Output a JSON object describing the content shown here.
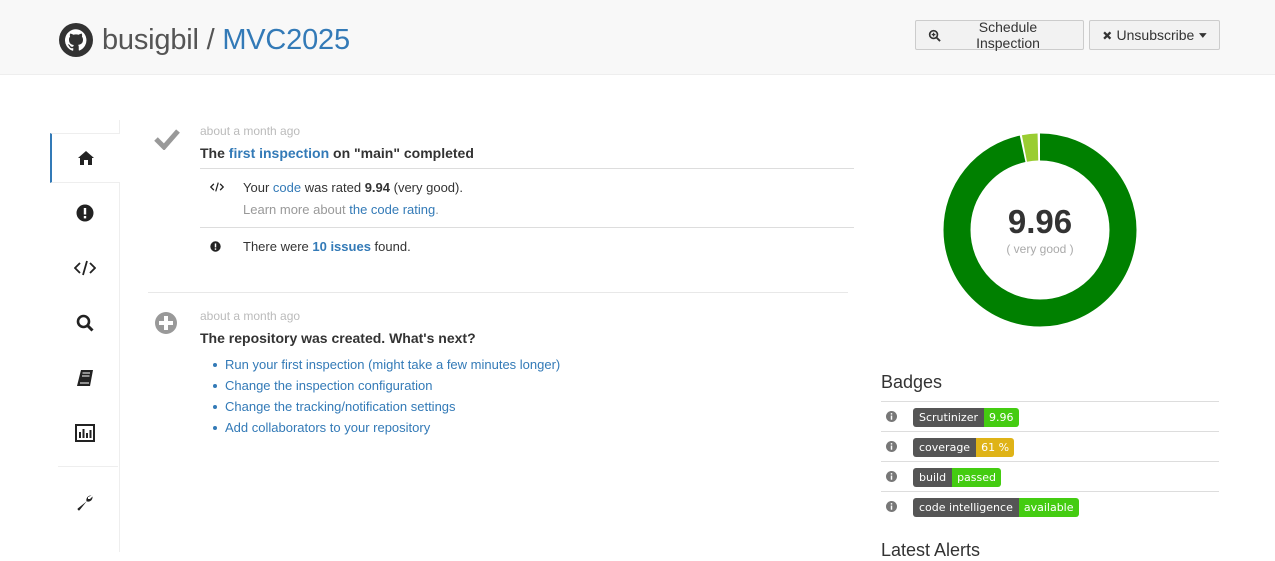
{
  "header": {
    "owner": "busigbil",
    "separator": " / ",
    "repo": "MVC2025",
    "schedule_label": "Schedule Inspection",
    "unsubscribe_label": "Unsubscribe"
  },
  "sidebar": {
    "items": [
      {
        "icon": "home-icon"
      },
      {
        "icon": "issues-icon"
      },
      {
        "icon": "code-icon"
      },
      {
        "icon": "search-icon"
      },
      {
        "icon": "book-icon"
      },
      {
        "icon": "chart-icon"
      },
      {
        "icon": "wrench-icon"
      }
    ]
  },
  "timeline": {
    "event1": {
      "time": "about a month ago",
      "title_pre": "The ",
      "title_link": "first inspection",
      "title_post": " on \"main\" completed",
      "rating_pre": "Your ",
      "rating_link": "code",
      "rating_mid": " was rated ",
      "rating_value": "9.94",
      "rating_post": " (very good).",
      "learn_pre": "Learn more about ",
      "learn_link": "the code rating",
      "learn_post": ".",
      "issues_pre": "There were ",
      "issues_link": "10 issues",
      "issues_post": " found."
    },
    "event2": {
      "time": "about a month ago",
      "title": "The repository was created. What's next?",
      "next_steps": [
        "Run your first inspection (might take a few minutes longer)",
        "Change the inspection configuration",
        "Change the tracking/notification settings",
        "Add collaborators to your repository"
      ]
    }
  },
  "score": {
    "value": "9.96",
    "label": "( very good )",
    "gauge_fraction_green": 0.97,
    "colors": {
      "good": "#008000",
      "ok": "#9acd32",
      "bad": "#ff0000"
    }
  },
  "badges": {
    "title": "Badges",
    "items": [
      {
        "left": "Scrutinizer",
        "right": "9.96",
        "color": "#44cc11"
      },
      {
        "left": "coverage",
        "right": "61 %",
        "color": "#dfb317"
      },
      {
        "left": "build",
        "right": "passed",
        "color": "#44cc11"
      },
      {
        "left": "code intelligence",
        "right": "available",
        "color": "#44cc11"
      }
    ]
  },
  "alerts": {
    "title": "Latest Alerts"
  }
}
